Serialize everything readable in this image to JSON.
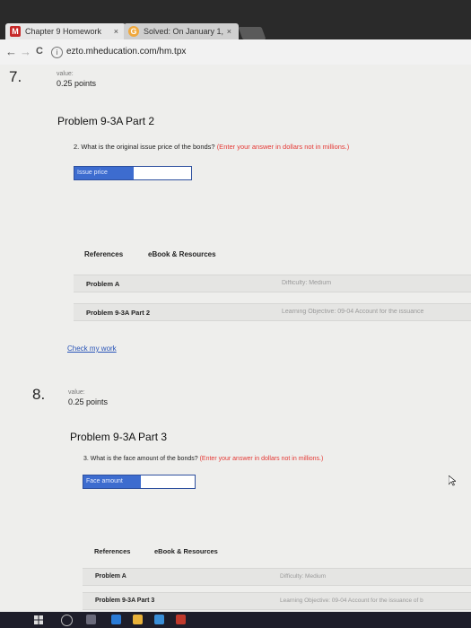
{
  "tabs": [
    {
      "favicon": "M",
      "label": "Chapter 9 Homework",
      "close": "×"
    },
    {
      "favicon": "G",
      "label": "Solved: On January 1,",
      "close": "×"
    }
  ],
  "nav": {
    "back": "←",
    "forward": "→",
    "reload": "C",
    "info_icon": "i"
  },
  "address": "ezto.mheducation.com/hm.tpx",
  "q7": {
    "number": "7.",
    "value_label": "value:",
    "points": "0.25 points",
    "title": "Problem 9-3A Part 2",
    "question": "2.  What is the original issue price of the bonds?",
    "hint": "(Enter your answer in dollars not in millions.)",
    "input_label": "Issue price",
    "tab_refs": "References",
    "tab_ebook": "eBook & Resources",
    "row1": "Problem A",
    "row1_meta": "Difficulty: Medium",
    "row2": "Problem 9-3A Part 2",
    "row2_meta": "Learning Objective: 09-04 Account for the issuance",
    "check": "Check my work"
  },
  "q8": {
    "number": "8.",
    "value_label": "value:",
    "points": "0.25 points",
    "title": "Problem 9-3A Part 3",
    "question": "3.  What is the face amount of the bonds?",
    "hint": "(Enter your answer in dollars not in millions.)",
    "input_label": "Face amount",
    "tab_refs": "References",
    "tab_ebook": "eBook & Resources",
    "row1": "Problem A",
    "row1_meta": "Difficulty: Medium",
    "row2": "Problem 9-3A Part 3",
    "row2_meta": "Learning Objective: 09-04 Account for the issuance of b"
  },
  "colors": {
    "hint": "#e53935",
    "input_accent": "#3d6ccf",
    "link": "#2a55b8"
  }
}
